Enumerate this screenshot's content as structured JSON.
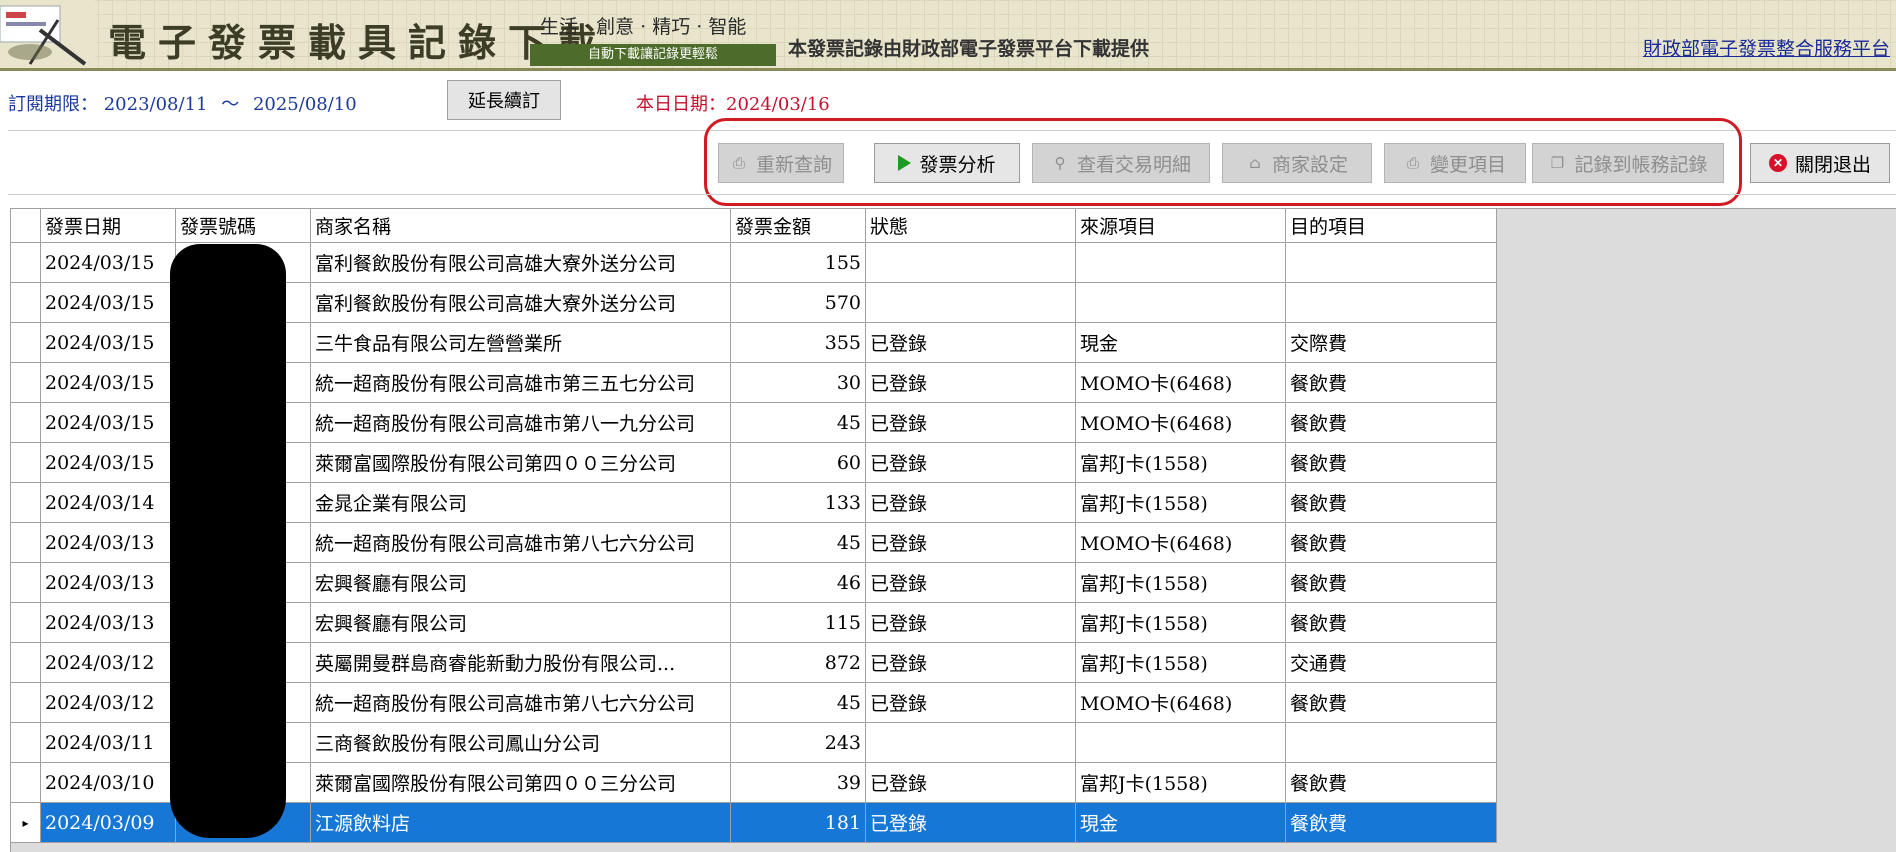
{
  "banner": {
    "title": "電子發票載具記錄下載",
    "slogan": "生活 · 創意 · 精巧 · 智能",
    "slogan_sub": "自動下載讓記錄更輕鬆",
    "provided_by": "本發票記錄由財政部電子發票平台下載提供",
    "mof_link": "財政部電子發票整合服務平台"
  },
  "subscription": {
    "label": "訂閱期限：",
    "start": "2023/08/11",
    "tilde": "～",
    "end": "2025/08/10",
    "extend_button": "延長續訂",
    "today_label": "本日日期：",
    "today": "2024/03/16"
  },
  "toolbar": {
    "requery": "重新查詢",
    "analyze": "發票分析",
    "details": "查看交易明細",
    "merchant_settings": "商家設定",
    "change_items": "變更項目",
    "record_to_ledger": "記錄到帳務記錄",
    "close_exit": "關閉退出"
  },
  "columns": [
    "發票日期",
    "發票號碼",
    "商家名稱",
    "發票金額",
    "狀態",
    "來源項目",
    "目的項目"
  ],
  "rows": [
    {
      "date": "2024/03/15",
      "number": "",
      "merchant": "富利餐飲股份有限公司高雄大寮外送分公司",
      "amount": "155",
      "status": "",
      "source": "",
      "target": ""
    },
    {
      "date": "2024/03/15",
      "number": "",
      "merchant": "富利餐飲股份有限公司高雄大寮外送分公司",
      "amount": "570",
      "status": "",
      "source": "",
      "target": ""
    },
    {
      "date": "2024/03/15",
      "number": "",
      "merchant": "三牛食品有限公司左營營業所",
      "amount": "355",
      "status": "已登錄",
      "source": "現金",
      "target": "交際費"
    },
    {
      "date": "2024/03/15",
      "number": "",
      "merchant": "統一超商股份有限公司高雄市第三五七分公司",
      "amount": "30",
      "status": "已登錄",
      "source": "MOMO卡(6468)",
      "target": "餐飲費"
    },
    {
      "date": "2024/03/15",
      "number": "",
      "merchant": "統一超商股份有限公司高雄市第八一九分公司",
      "amount": "45",
      "status": "已登錄",
      "source": "MOMO卡(6468)",
      "target": "餐飲費"
    },
    {
      "date": "2024/03/15",
      "number": "",
      "merchant": "萊爾富國際股份有限公司第四００三分公司",
      "amount": "60",
      "status": "已登錄",
      "source": "富邦J卡(1558)",
      "target": "餐飲費"
    },
    {
      "date": "2024/03/14",
      "number": "",
      "merchant": "金晁企業有限公司",
      "amount": "133",
      "status": "已登錄",
      "source": "富邦J卡(1558)",
      "target": "餐飲費"
    },
    {
      "date": "2024/03/13",
      "number": "",
      "merchant": "統一超商股份有限公司高雄市第八七六分公司",
      "amount": "45",
      "status": "已登錄",
      "source": "MOMO卡(6468)",
      "target": "餐飲費"
    },
    {
      "date": "2024/03/13",
      "number": "",
      "merchant": "宏興餐廳有限公司",
      "amount": "46",
      "status": "已登錄",
      "source": "富邦J卡(1558)",
      "target": "餐飲費"
    },
    {
      "date": "2024/03/13",
      "number": "",
      "merchant": "宏興餐廳有限公司",
      "amount": "115",
      "status": "已登錄",
      "source": "富邦J卡(1558)",
      "target": "餐飲費"
    },
    {
      "date": "2024/03/12",
      "number": "",
      "merchant": "英屬開曼群島商睿能新動力股份有限公司...",
      "amount": "872",
      "status": "已登錄",
      "source": "富邦J卡(1558)",
      "target": "交通費"
    },
    {
      "date": "2024/03/12",
      "number": "",
      "merchant": "統一超商股份有限公司高雄市第八七六分公司",
      "amount": "45",
      "status": "已登錄",
      "source": "MOMO卡(6468)",
      "target": "餐飲費"
    },
    {
      "date": "2024/03/11",
      "number": "",
      "merchant": "三商餐飲股份有限公司鳳山分公司",
      "amount": "243",
      "status": "",
      "source": "",
      "target": ""
    },
    {
      "date": "2024/03/10",
      "number": "",
      "merchant": "萊爾富國際股份有限公司第四００三分公司",
      "amount": "39",
      "status": "已登錄",
      "source": "富邦J卡(1558)",
      "target": "餐飲費"
    },
    {
      "date": "2024/03/09",
      "number": "",
      "merchant": "江源飲料店",
      "amount": "181",
      "status": "已登錄",
      "source": "現金",
      "target": "餐飲費"
    }
  ],
  "selected_row": 14,
  "colors": {
    "selection": "#1677d6",
    "highlight_box": "#d21a22",
    "info_text": "#1b3a9a",
    "today_text": "#c8102e"
  }
}
